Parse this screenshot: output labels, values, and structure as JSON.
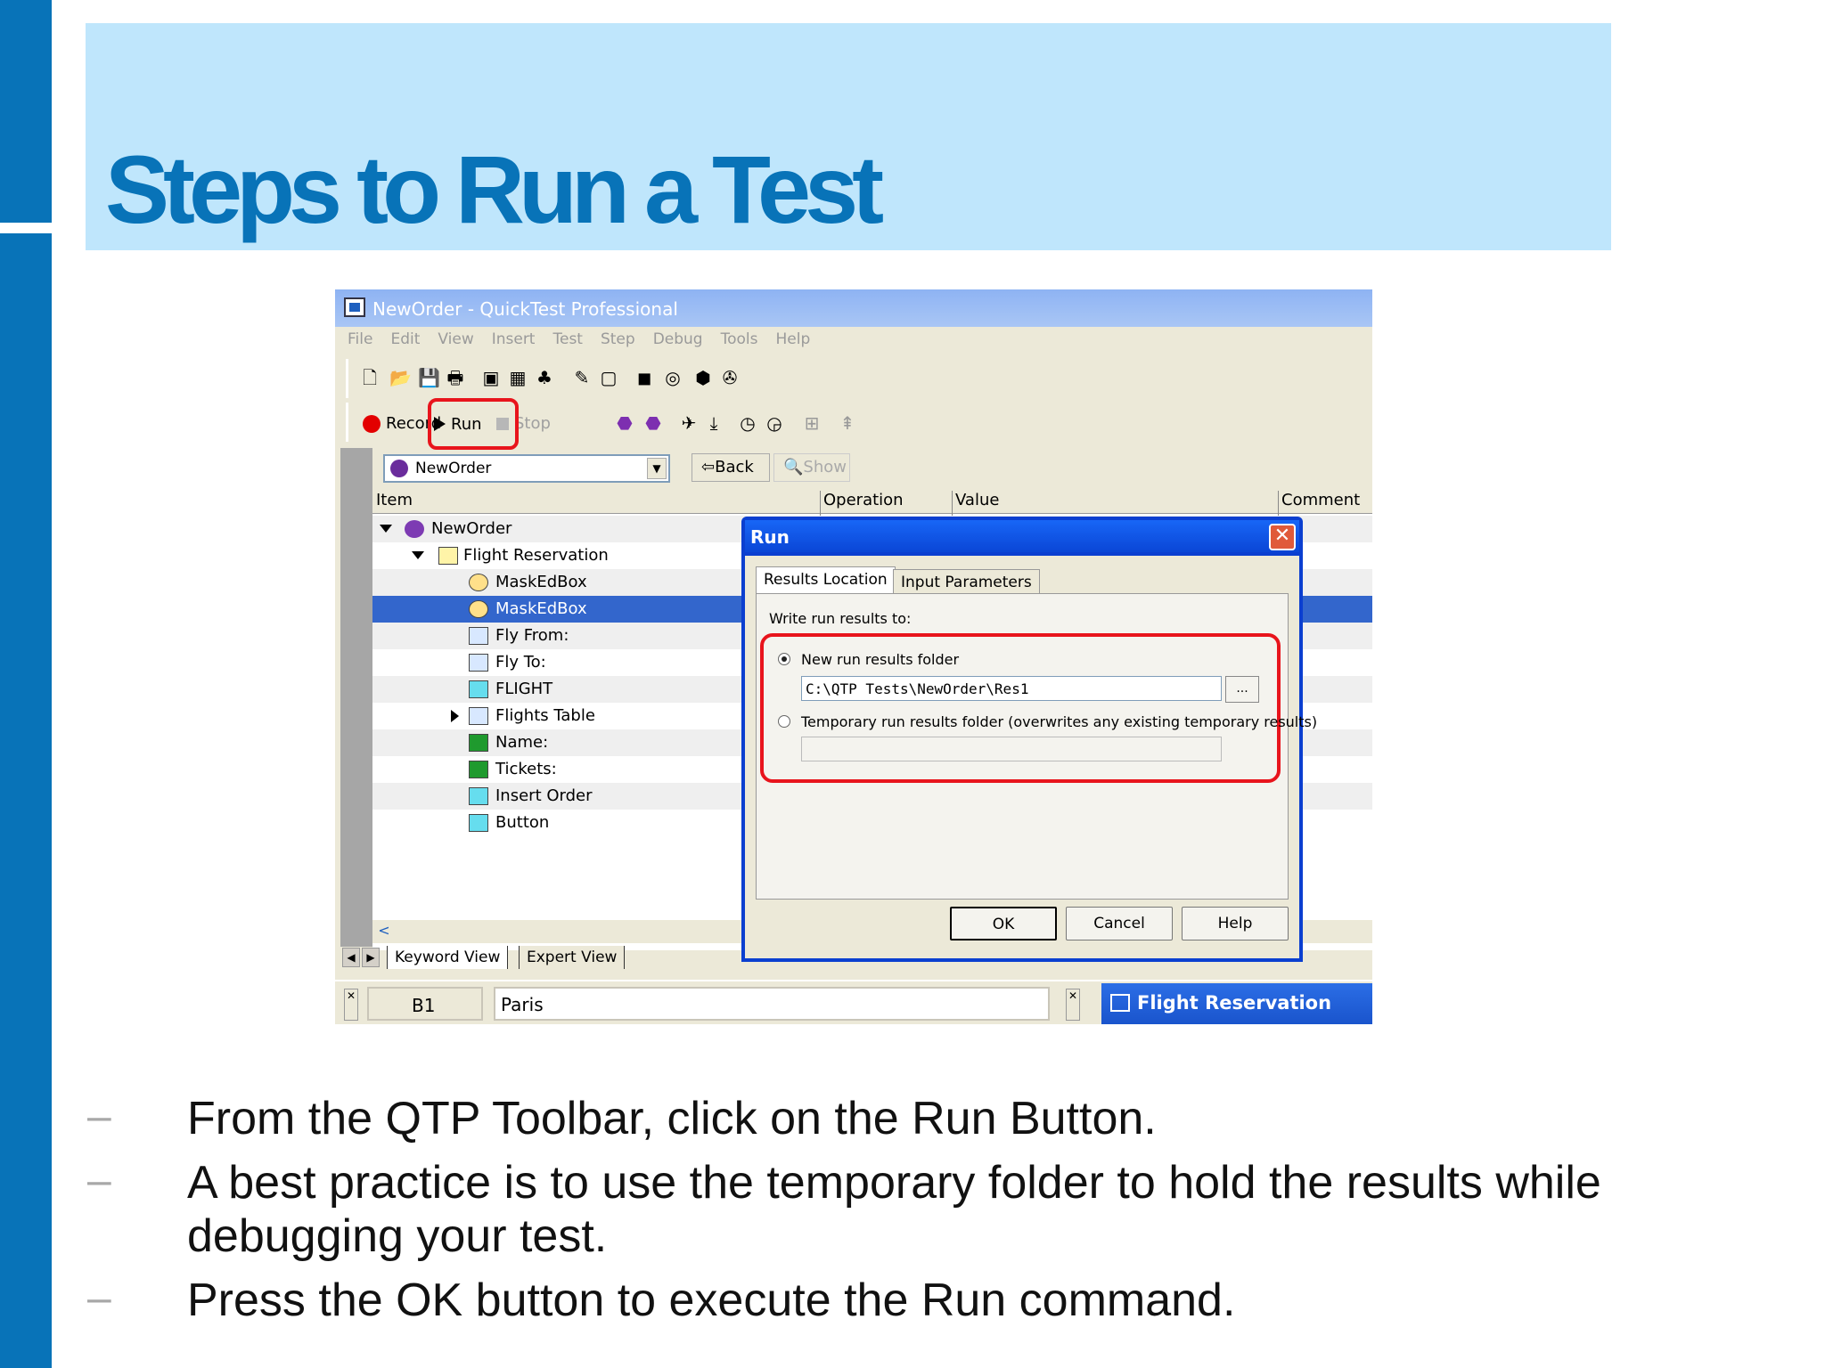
{
  "slide": {
    "title": "Steps to Run a Test",
    "bullets": [
      "From the QTP Toolbar, click on the Run Button.",
      "A best practice is to use the temporary folder to hold the results while debugging your test.",
      "Press the OK button to execute the Run command."
    ],
    "bullet_marker": "–"
  },
  "app": {
    "title": "NewOrder - QuickTest Professional",
    "menu": [
      "File",
      "Edit",
      "View",
      "Insert",
      "Test",
      "Step",
      "Debug",
      "Tools",
      "Help"
    ],
    "toolbar": {
      "record_label": "Record",
      "run_label": "Run",
      "stop_label": "Stop"
    },
    "object_combo": "NewOrder",
    "back_label": "Back",
    "show_label": "Show",
    "grid_headers": {
      "item": "Item",
      "operation": "Operation",
      "value": "Value",
      "comment": "Comment"
    },
    "tree": [
      {
        "label": "NewOrder"
      },
      {
        "label": "Flight Reservation"
      },
      {
        "label": "MaskEdBox"
      },
      {
        "label": "MaskEdBox"
      },
      {
        "label": "Fly From:"
      },
      {
        "label": "Fly To:"
      },
      {
        "label": "FLIGHT"
      },
      {
        "label": "Flights Table"
      },
      {
        "label": "Name:"
      },
      {
        "label": "Tickets:"
      },
      {
        "label": "Insert Order"
      },
      {
        "label": "Button"
      }
    ],
    "view_tabs": [
      "Keyword View",
      "Expert View"
    ],
    "cell_ref": "B1",
    "cell_value": "Paris",
    "taskbar_item": "Flight Reservation"
  },
  "dialog": {
    "title": "Run",
    "tabs": [
      "Results Location",
      "Input Parameters"
    ],
    "write_label": "Write run results to:",
    "option_new": "New run results folder",
    "path_value": "C:\\QTP Tests\\NewOrder\\Res1",
    "browse_label": "...",
    "option_temp": "Temporary run results folder (overwrites any existing temporary results)",
    "buttons": {
      "ok": "OK",
      "cancel": "Cancel",
      "help": "Help"
    }
  },
  "colors": {
    "slide_blue": "#0873b8",
    "title_band": "#bfe6fc",
    "highlight_red": "#e8141c",
    "selection_blue": "#3366cc"
  }
}
